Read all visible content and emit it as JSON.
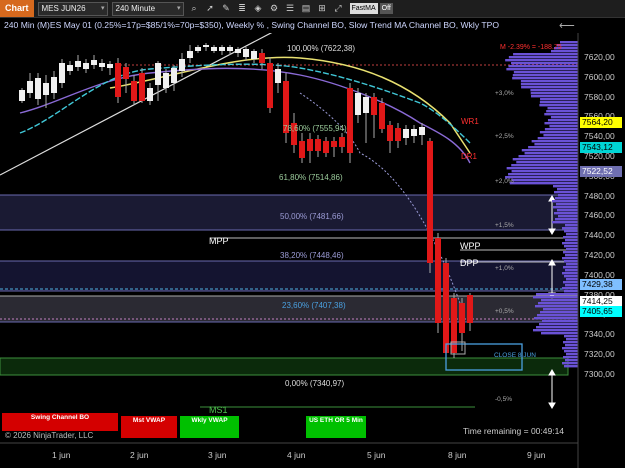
{
  "toolbar": {
    "chart_label": "Chart",
    "instrument": "MES JUN26",
    "interval": "240 Minute",
    "fastma": "FastMA",
    "off": "Off"
  },
  "title": "240 Min (M)ES May 01 (0.25%=17p=$85/1%=70p=$350), Weekly % , Swing Channel BO, Slow Trend MA Channel BO, Wkly TPO",
  "top_marker": "M -2.39% = -188.75",
  "fib_labels": [
    {
      "text": "100,00% (7622,38)"
    },
    {
      "text": "78,60% (7555,94)"
    },
    {
      "text": "61,80% (7514,86)"
    },
    {
      "text": "50,00% (7481,66)"
    },
    {
      "text": "38,20% (7448,46)"
    },
    {
      "text": "23,60% (7407,38)"
    },
    {
      "text": "0,00% (7340,97)"
    }
  ],
  "pct_labels": [
    "+3,0%",
    "+2,5%",
    "+2,0%",
    "+1,5%",
    "+1,0%",
    "+0,5%",
    "-0,5%"
  ],
  "annotations": {
    "wr1": "WR1",
    "dr1": "DR1",
    "mpp": "MPP",
    "wpp": "WPP",
    "dpp": "DPP",
    "ms1": "MS1",
    "close": "CLOSE 8 JUN",
    "time_remaining": "Time remaining = 00:49:14",
    "copyright": "© 2026 NinjaTrader, LLC"
  },
  "price_axis": [
    "7620,00",
    "7600,00",
    "7580,00",
    "7560,00",
    "7540,00",
    "7520,00",
    "7500,00",
    "7480,00",
    "7460,00",
    "7440,00",
    "7420,00",
    "7400,00",
    "7380,00",
    "7360,00",
    "7340,00",
    "7320,00",
    "7300,00"
  ],
  "price_badges": [
    {
      "text": "7564,20",
      "bg": "#ffff00",
      "fg": "#000000"
    },
    {
      "text": "7543,12",
      "bg": "#00d5d5",
      "fg": "#000000"
    },
    {
      "text": "7522,52",
      "bg": "#6f6fb0",
      "fg": "#ffffff"
    },
    {
      "text": "7429,38",
      "bg": "#7fbfff",
      "fg": "#000000"
    },
    {
      "text": "7414,25",
      "bg": "#ffffff",
      "fg": "#000000"
    },
    {
      "text": "7405,65",
      "bg": "#00ffff",
      "fg": "#000000"
    }
  ],
  "time_axis": [
    "1 jun",
    "2 jun",
    "3 jun",
    "4 jun",
    "5 jun",
    "8 jun",
    "9 jun"
  ],
  "buttons": [
    {
      "label": "Swing Channel BO",
      "color": "#d40000"
    },
    {
      "label": "Mst VWAP",
      "color": "#d40000"
    },
    {
      "label": "Wkly VWAP",
      "color": "#00c000"
    },
    {
      "label": "US ETH OR 5 Min",
      "color": "#00c000"
    }
  ]
}
